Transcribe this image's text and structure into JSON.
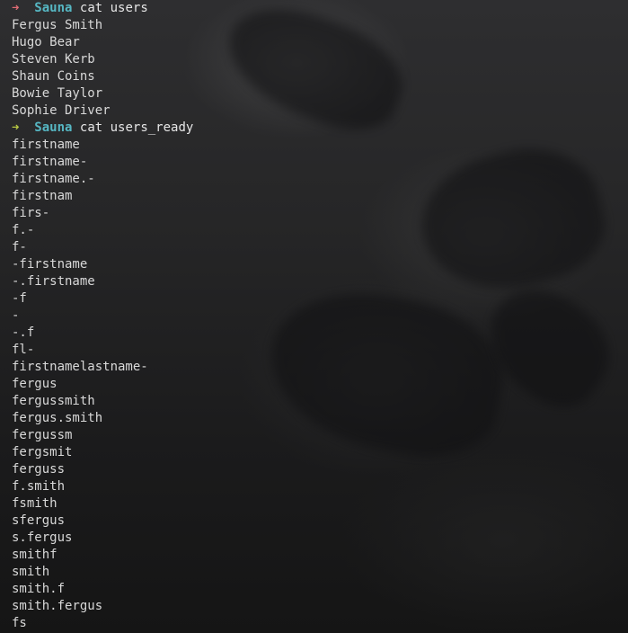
{
  "prompts": [
    {
      "status": "fail",
      "arrow": "➜",
      "dir": "Sauna",
      "command": "cat users",
      "colors": {
        "arrow": "#e06c75",
        "dir": "#56b6c2"
      },
      "output": [
        "Fergus Smith",
        "Hugo Bear",
        "Steven Kerb",
        "Shaun Coins",
        "Bowie Taylor",
        "Sophie Driver"
      ]
    },
    {
      "status": "ok",
      "arrow": "➜",
      "dir": "Sauna",
      "command": "cat users_ready",
      "colors": {
        "arrow": "#b8c943",
        "dir": "#56b6c2"
      },
      "output": [
        "firstname",
        "firstname-",
        "firstname.-",
        "firstnam",
        "firs-",
        "f.-",
        "f-",
        "-firstname",
        "-.firstname",
        "-f",
        "-",
        "-.f",
        "fl-",
        "firstnamelastname-",
        "fergus",
        "fergussmith",
        "fergus.smith",
        "fergussm",
        "fergsmit",
        "ferguss",
        "f.smith",
        "fsmith",
        "sfergus",
        "s.fergus",
        "smithf",
        "smith",
        "smith.f",
        "smith.fergus",
        "fs"
      ]
    }
  ],
  "background": "dark-raven-wallpaper"
}
